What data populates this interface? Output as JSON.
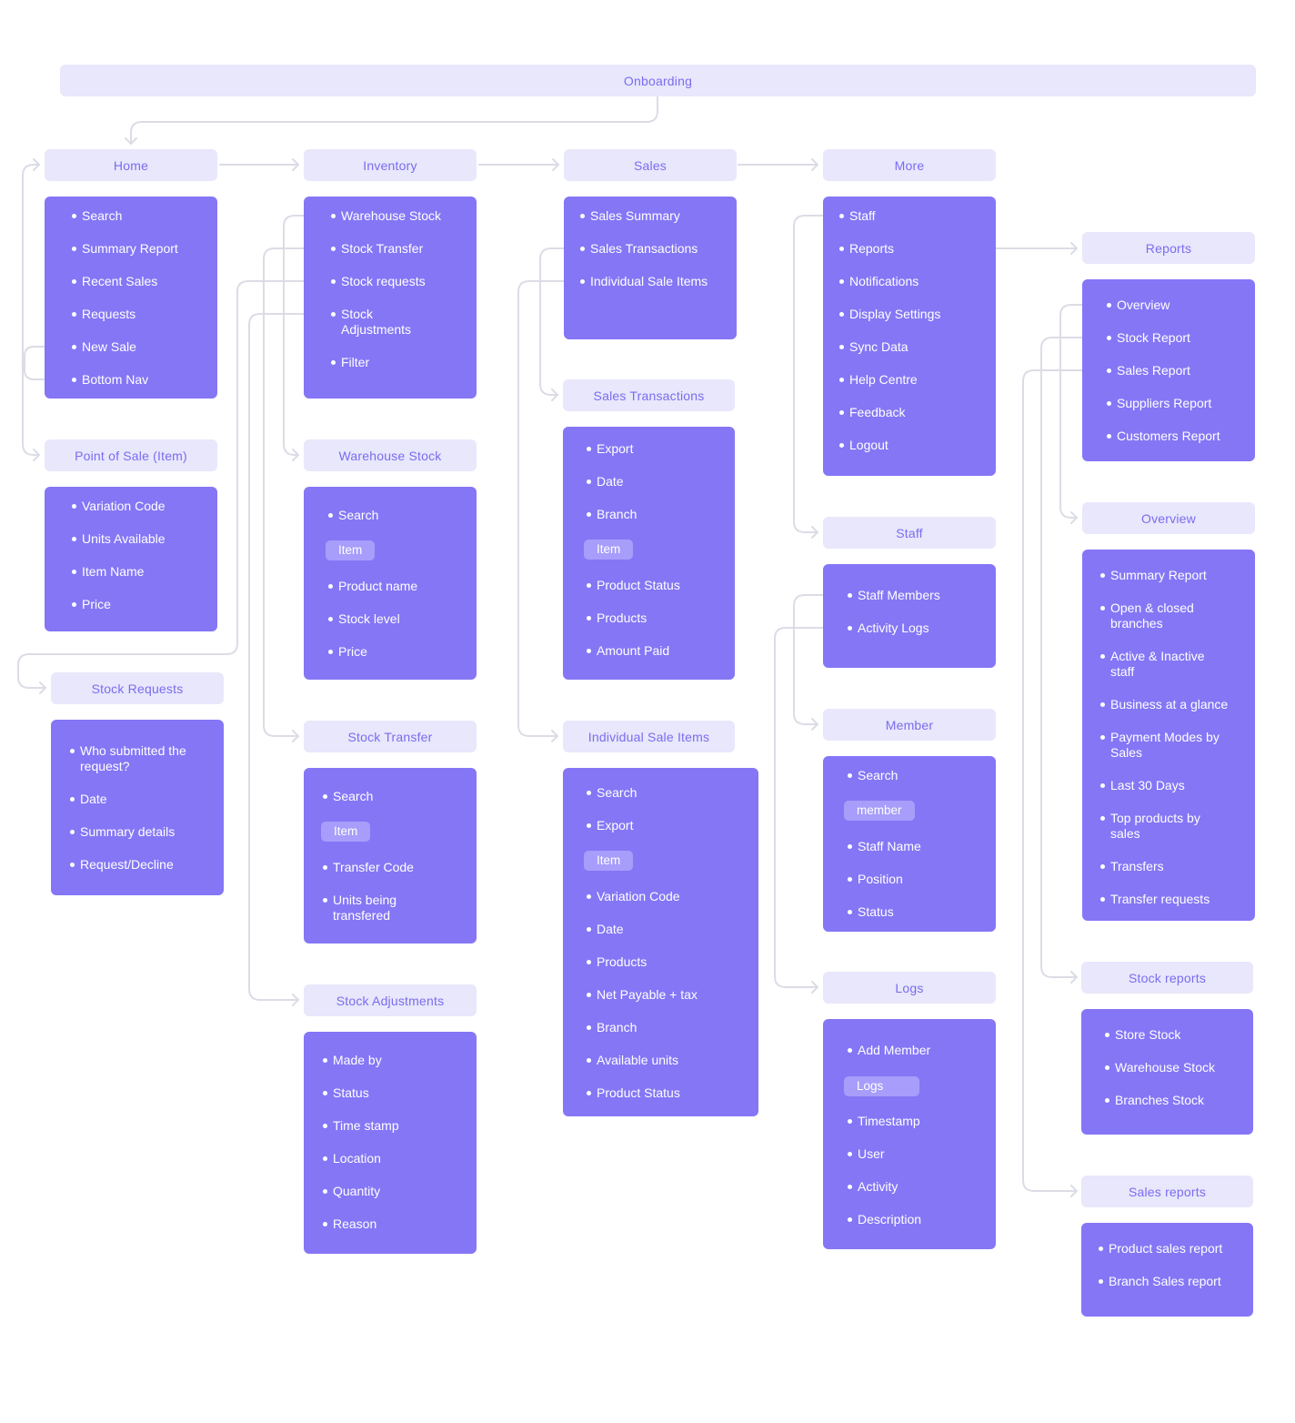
{
  "onboarding": "Onboarding",
  "columns": {
    "home": "Home",
    "inventory": "Inventory",
    "sales": "Sales",
    "more": "More"
  },
  "home_items": [
    "Search",
    "Summary Report",
    "Recent Sales",
    "Requests",
    "New Sale",
    "Bottom Nav"
  ],
  "inventory_items": [
    "Warehouse Stock",
    "Stock Transfer",
    "Stock requests",
    "Stock\nAdjustments",
    "Filter"
  ],
  "sales_items": [
    "Sales Summary",
    "Sales Transactions",
    "Individual Sale Items"
  ],
  "more_items": [
    "Staff",
    "Reports",
    "Notifications",
    "Display Settings",
    "Sync Data",
    "Help Centre",
    "Feedback",
    "Logout"
  ],
  "pos": {
    "title": "Point of Sale (Item)",
    "items": [
      "Variation Code",
      "Units Available",
      "Item Name",
      "Price"
    ]
  },
  "stock_requests": {
    "title": "Stock Requests",
    "items": [
      "Who submitted the\nrequest?",
      "Date",
      "Summary details",
      "Request/Decline"
    ]
  },
  "warehouse_stock": {
    "title": "Warehouse Stock",
    "items": [
      "Search",
      "Item",
      "Product name",
      "Stock level",
      "Price"
    ]
  },
  "stock_transfer": {
    "title": "Stock Transfer",
    "items": [
      "Search",
      "Item",
      "Transfer Code",
      "Units being\ntransfered"
    ]
  },
  "stock_adjustments": {
    "title": "Stock Adjustments",
    "items": [
      "Made by",
      "Status",
      "Time stamp",
      "Location",
      "Quantity",
      "Reason"
    ]
  },
  "sales_transactions": {
    "title": "Sales Transactions",
    "items": [
      "Export",
      "Date",
      "Branch",
      "Item",
      "Product Status",
      "Products",
      "Amount Paid"
    ]
  },
  "individual_sale_items": {
    "title": "Individual Sale Items",
    "items": [
      "Search",
      "Export",
      "Item",
      "Variation Code",
      "Date",
      "Products",
      "Net Payable + tax",
      "Branch",
      "Available units",
      "Product Status"
    ]
  },
  "staff": {
    "title": "Staff",
    "items": [
      "Staff Members",
      "Activity Logs"
    ]
  },
  "member": {
    "title": "Member",
    "items": [
      "Search",
      "member",
      "Staff Name",
      "Position",
      "Status"
    ]
  },
  "logs": {
    "title": "Logs",
    "items": [
      "Add Member",
      "Logs",
      "Timestamp",
      "User",
      "Activity",
      "Description"
    ]
  },
  "reports": {
    "title": "Reports",
    "items": [
      "Overview",
      "Stock Report",
      "Sales Report",
      "Suppliers Report",
      "Customers Report"
    ]
  },
  "overview": {
    "title": "Overview",
    "items": [
      "Summary Report",
      "Open & closed\nbranches",
      "Active & Inactive\nstaff",
      "Business at a glance",
      "Payment Modes by\nSales",
      "Last 30 Days",
      "Top products by\nsales",
      "Transfers",
      "Transfer requests"
    ]
  },
  "stock_reports": {
    "title": "Stock reports",
    "items": [
      "Store Stock",
      "Warehouse Stock",
      "Branches Stock"
    ]
  },
  "sales_reports": {
    "title": "Sales reports",
    "items": [
      "Product sales report",
      "Branch Sales report"
    ]
  },
  "colors": {
    "card": "#8576f6",
    "header_bg": "#e8e7fb",
    "header_text": "#7b6cf0",
    "connector": "#dcdce6"
  }
}
